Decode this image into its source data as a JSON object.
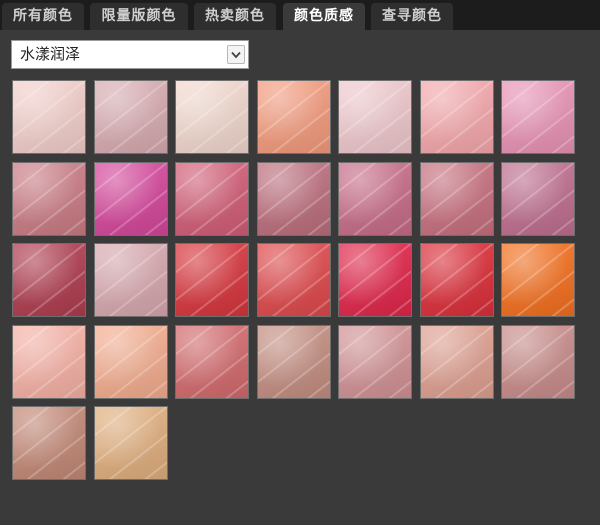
{
  "tabs": [
    {
      "label": "所有颜色",
      "active": false
    },
    {
      "label": "限量版颜色",
      "active": false
    },
    {
      "label": "热卖颜色",
      "active": false
    },
    {
      "label": "颜色质感",
      "active": true
    },
    {
      "label": "查寻颜色",
      "active": false
    }
  ],
  "filter": {
    "selected": "水漾润泽"
  },
  "swatches": [
    "#f4d0cc",
    "#d9adb3",
    "#f3d9cf",
    "#f59c7e",
    "#f0c9ce",
    "#f6a9ad",
    "#ea94b6",
    "#cb7c85",
    "#d6479c",
    "#d35e78",
    "#bd6f7e",
    "#c96d8a",
    "#c8707f",
    "#c06f90",
    "#b03d50",
    "#d8a9b0",
    "#d8363d",
    "#e0494c",
    "#e2264b",
    "#dd2f3a",
    "#f5701f",
    "#f7b2a6",
    "#f5ae90",
    "#d46b6e",
    "#c58f82",
    "#d39396",
    "#e0a192",
    "#c98d8b",
    "#c48977",
    "#e2b07f"
  ]
}
